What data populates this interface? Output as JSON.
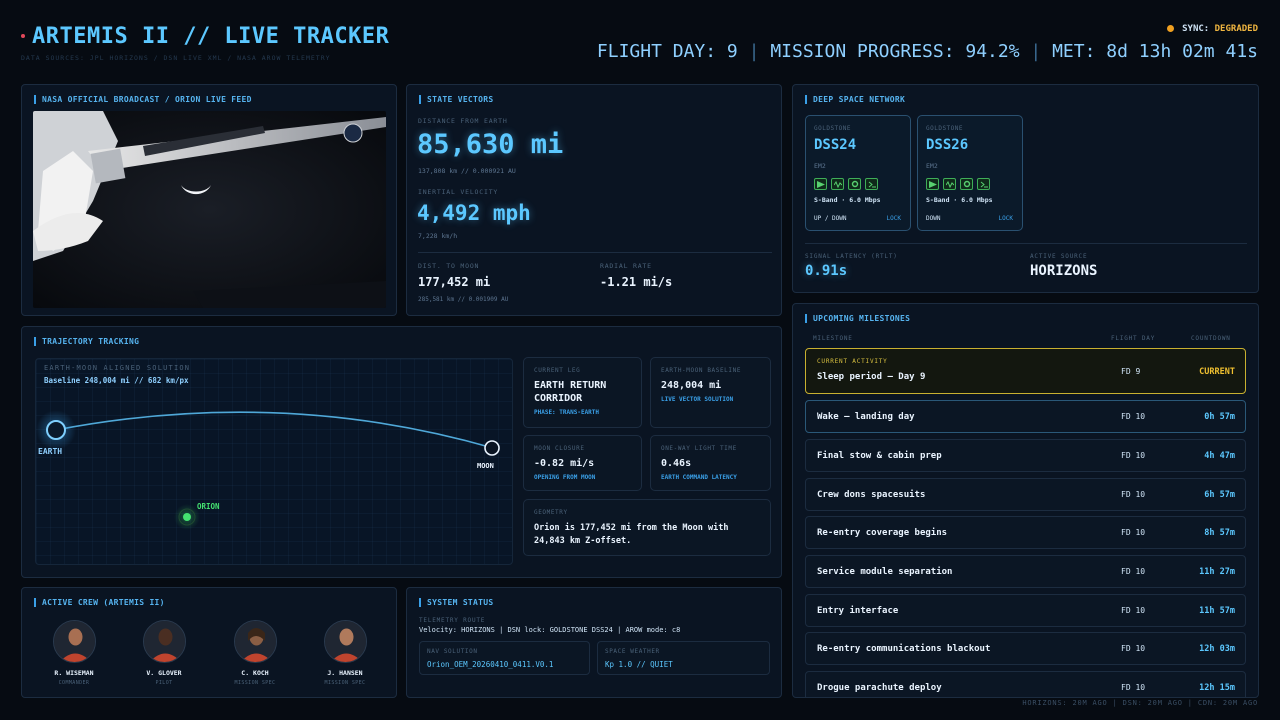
{
  "header": {
    "title": "ARTEMIS II // LIVE TRACKER",
    "data_sources": "DATA SOURCES: JPL HORIZONS / DSN LIVE XML / NASA AROW TELEMETRY",
    "sync_label": "SYNC:",
    "sync_state": "DEGRADED",
    "flight_day": "FLIGHT DAY: 9",
    "mission_progress": "MISSION PROGRESS: 94.2%",
    "met": "MET: 8d 13h 02m 41s",
    "separator": "|"
  },
  "broadcast": {
    "title": "NASA OFFICIAL BROADCAST / ORION LIVE FEED"
  },
  "state_vectors": {
    "title": "STATE VECTORS",
    "distance_label": "DISTANCE FROM EARTH",
    "distance_value": "85,630 mi",
    "distance_sub": "137,808 km // 0.000921 AU",
    "velocity_label": "INERTIAL VELOCITY",
    "velocity_value": "4,492 mph",
    "velocity_sub": "7,228 km/h",
    "moon_label": "DIST. TO MOON",
    "moon_value": "177,452 mi",
    "moon_sub": "285,581 km // 0.001909 AU",
    "radial_label": "RADIAL RATE",
    "radial_value": "-1.21 mi/s"
  },
  "dsn": {
    "title": "DEEP SPACE NETWORK",
    "stations": [
      {
        "site": "GOLDSTONE",
        "name": "DSS24",
        "spacecraft": "EM2",
        "band": "S-Band · 6.0 Mbps",
        "direction": "UP / DOWN",
        "lock": "LOCK"
      },
      {
        "site": "GOLDSTONE",
        "name": "DSS26",
        "spacecraft": "EM2",
        "band": "S-Band · 6.0 Mbps",
        "direction": "DOWN",
        "lock": "LOCK"
      }
    ],
    "latency_label": "SIGNAL LATENCY (RTLT)",
    "latency_value": "0.91s",
    "source_label": "ACTIVE SOURCE",
    "source_value": "HORIZONS"
  },
  "trajectory": {
    "title": "TRAJECTORY TRACKING",
    "solution_label": "EARTH-MOON ALIGNED SOLUTION",
    "baseline_text": "Baseline 248,004 mi // 682 km/px",
    "earth_label": "EARTH",
    "moon_label": "MOON",
    "orion_label": "ORION",
    "cards": {
      "leg_label": "CURRENT LEG",
      "leg_value": "EARTH RETURN CORRIDOR",
      "leg_sub": "PHASE: TRANS-EARTH",
      "baseline_label": "EARTH-MOON BASELINE",
      "baseline_value": "248,004 mi",
      "baseline_sub": "LIVE VECTOR SOLUTION",
      "closure_label": "MOON CLOSURE",
      "closure_value": "-0.82 mi/s",
      "closure_sub": "OPENING FROM MOON",
      "light_label": "ONE-WAY LIGHT TIME",
      "light_value": "0.46s",
      "light_sub": "EARTH COMMAND LATENCY",
      "geometry_label": "GEOMETRY",
      "geometry_value": "Orion is 177,452 mi from the Moon with 24,843 km Z-offset."
    }
  },
  "crew": {
    "title": "ACTIVE CREW (ARTEMIS II)",
    "members": [
      {
        "name": "R. WISEMAN",
        "role": "COMMANDER"
      },
      {
        "name": "V. GLOVER",
        "role": "PILOT"
      },
      {
        "name": "C. KOCH",
        "role": "MISSION SPEC"
      },
      {
        "name": "J. HANSEN",
        "role": "MISSION SPEC"
      }
    ]
  },
  "system_status": {
    "title": "SYSTEM STATUS",
    "route_label": "TELEMETRY ROUTE",
    "route_value": "Velocity: HORIZONS | DSN lock: GOLDSTONE DSS24 | AROW mode: c8",
    "nav_label": "NAV SOLUTION",
    "nav_value": "Orion_OEM_20260410_0411.V0.1",
    "weather_label": "SPACE WEATHER",
    "weather_value": "Kp 1.0 // QUIET"
  },
  "milestones": {
    "title": "UPCOMING MILESTONES",
    "col_milestone": "MILESTONE",
    "col_day": "FLIGHT DAY",
    "col_countdown": "COUNTDOWN",
    "current": {
      "label": "CURRENT ACTIVITY",
      "title": "Sleep period — Day 9",
      "day": "FD 9",
      "countdown": "CURRENT"
    },
    "items": [
      {
        "title": "Wake — landing day",
        "day": "FD 10",
        "countdown": "0h 57m"
      },
      {
        "title": "Final stow & cabin prep",
        "day": "FD 10",
        "countdown": "4h 47m"
      },
      {
        "title": "Crew dons spacesuits",
        "day": "FD 10",
        "countdown": "6h 57m"
      },
      {
        "title": "Re-entry coverage begins",
        "day": "FD 10",
        "countdown": "8h 57m"
      },
      {
        "title": "Service module separation",
        "day": "FD 10",
        "countdown": "11h 27m"
      },
      {
        "title": "Entry interface",
        "day": "FD 10",
        "countdown": "11h 57m"
      },
      {
        "title": "Re-entry communications blackout",
        "day": "FD 10",
        "countdown": "12h 03m"
      },
      {
        "title": "Drogue parachute deploy",
        "day": "FD 10",
        "countdown": "12h 15m"
      }
    ]
  },
  "footer": {
    "text": "HORIZONS: 20M AGO | DSN: 20M AGO | CDN: 20M AGO"
  }
}
